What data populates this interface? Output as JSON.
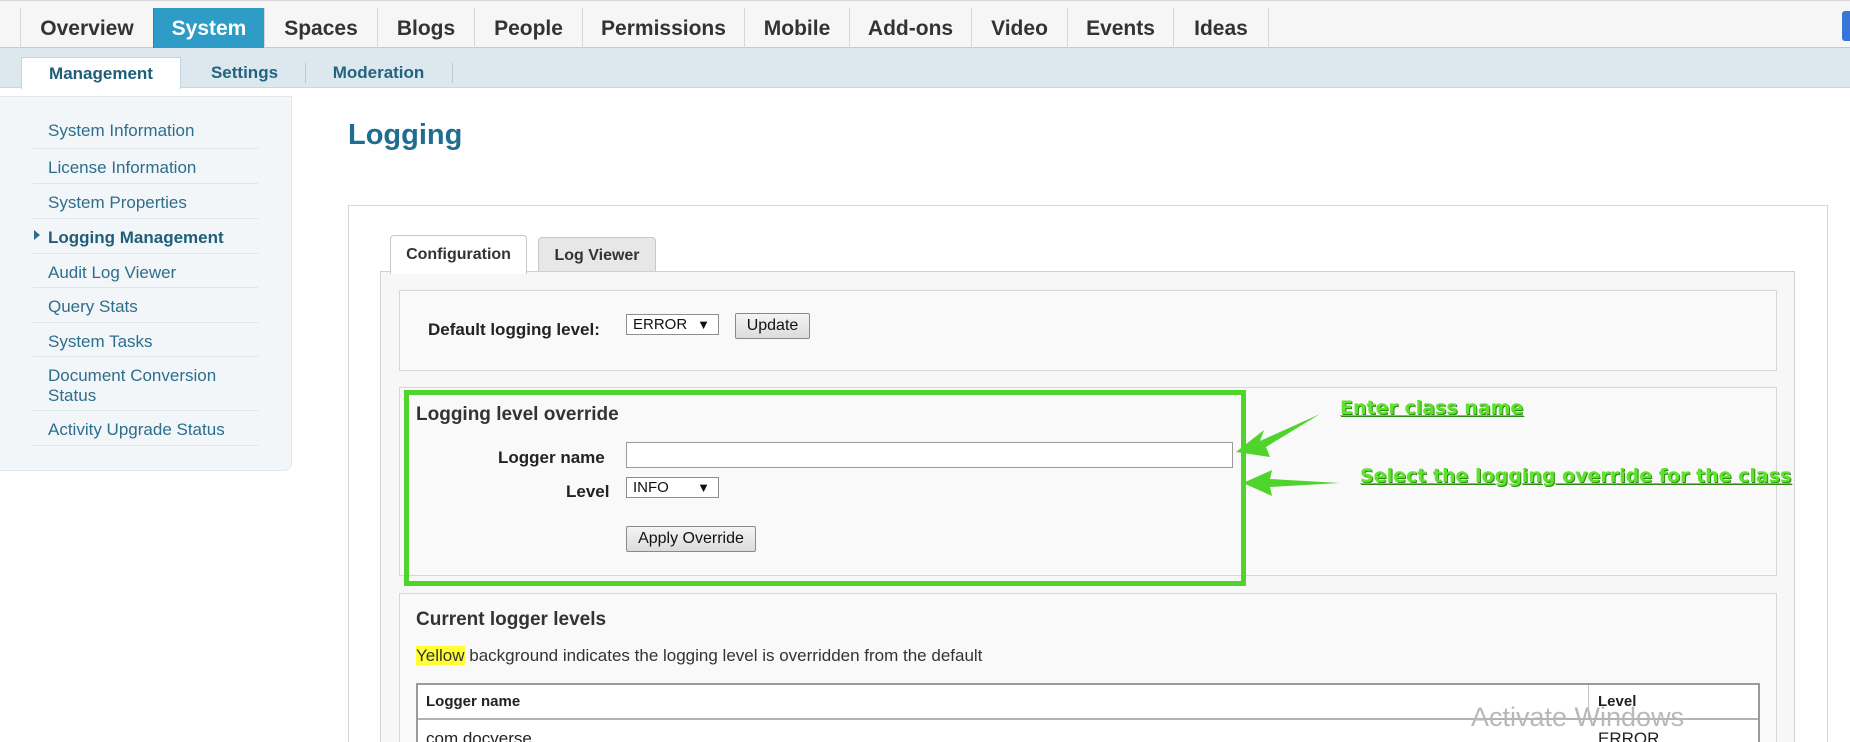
{
  "top_nav": {
    "tabs": [
      {
        "label": "Overview"
      },
      {
        "label": "System",
        "active": true
      },
      {
        "label": "Spaces"
      },
      {
        "label": "Blogs"
      },
      {
        "label": "People"
      },
      {
        "label": "Permissions"
      },
      {
        "label": "Mobile"
      },
      {
        "label": "Add-ons"
      },
      {
        "label": "Video"
      },
      {
        "label": "Events"
      },
      {
        "label": "Ideas"
      }
    ]
  },
  "sub_nav": {
    "tabs": [
      {
        "label": "Management",
        "active": true
      },
      {
        "label": "Settings"
      },
      {
        "label": "Moderation"
      }
    ]
  },
  "sidebar": {
    "items": [
      {
        "label": "System Information"
      },
      {
        "label": "License Information"
      },
      {
        "label": "System Properties"
      },
      {
        "label": "Logging Management",
        "active": true
      },
      {
        "label": "Audit Log Viewer"
      },
      {
        "label": "Query Stats"
      },
      {
        "label": "System Tasks"
      },
      {
        "label": "Document Conversion Status"
      },
      {
        "label": "Activity Upgrade Status"
      }
    ]
  },
  "main": {
    "title": "Logging",
    "tabs": [
      {
        "label": "Configuration",
        "active": true
      },
      {
        "label": "Log Viewer"
      }
    ],
    "default_level": {
      "label": "Default logging level:",
      "value": "ERROR",
      "button": "Update"
    },
    "override": {
      "title": "Logging level override",
      "logger_label": "Logger name",
      "logger_value": "",
      "level_label": "Level",
      "level_value": "INFO",
      "button": "Apply Override"
    },
    "current": {
      "title": "Current logger levels",
      "legend_highlight": "Yellow",
      "legend_rest": " background indicates the logging level is overridden from the default",
      "columns": [
        "Logger name",
        "Level"
      ],
      "rows": [
        {
          "name": "com.docverse",
          "level": "ERROR"
        }
      ]
    }
  },
  "annotations": {
    "enter_class": "Enter class name",
    "select_override": "Select the logging override for the class",
    "color": "#5de32e"
  },
  "watermark": "Activate Windows",
  "caret": "▼",
  "colors": {
    "active_tab": "#2f9bc7",
    "link": "#2c6e8d",
    "title": "#1f6e91",
    "highlight_border": "#4fd42c"
  }
}
